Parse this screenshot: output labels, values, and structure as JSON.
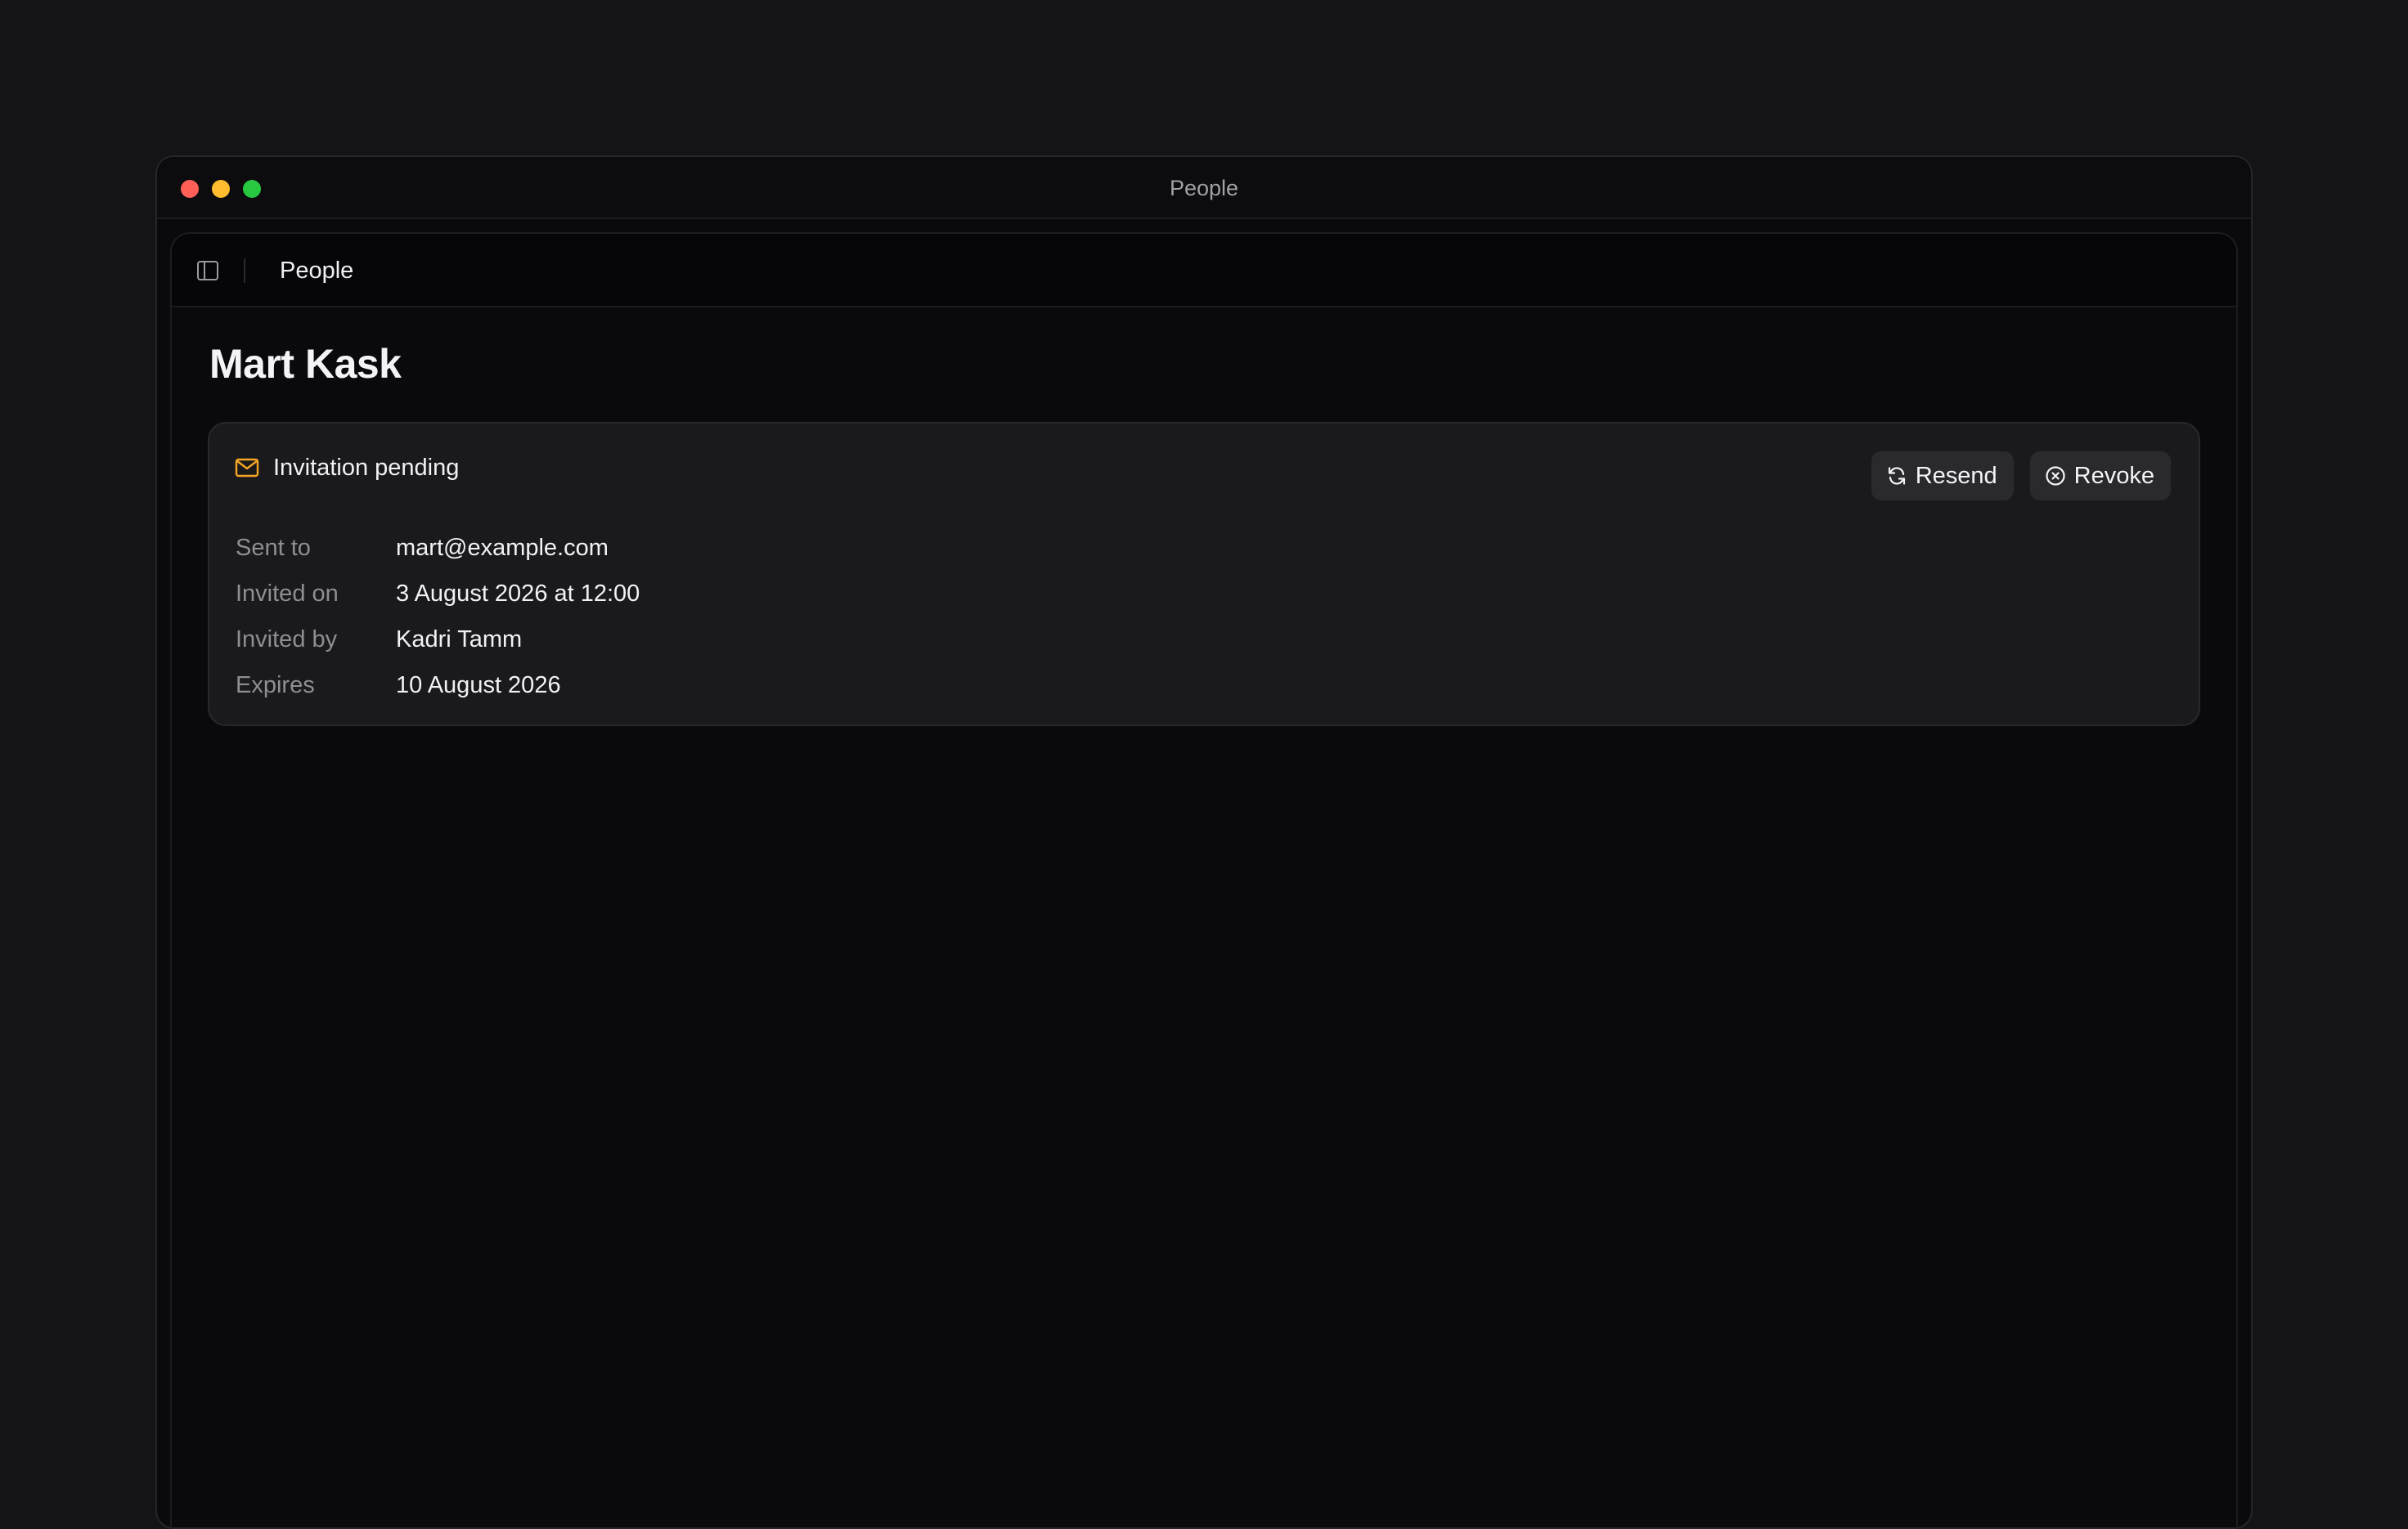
{
  "window": {
    "title": "People"
  },
  "header": {
    "breadcrumb": "People"
  },
  "page": {
    "title": "Mart Kask"
  },
  "invitation": {
    "status": "Invitation pending",
    "status_icon": "mail-icon",
    "status_color": "#f5a524",
    "actions": {
      "resend_label": "Resend",
      "revoke_label": "Revoke"
    },
    "details": [
      {
        "label": "Sent to",
        "value": "mart@example.com"
      },
      {
        "label": "Invited on",
        "value": "3 August 2026 at 12:00"
      },
      {
        "label": "Invited by",
        "value": "Kadri Tamm"
      },
      {
        "label": "Expires",
        "value": "10 August 2026"
      }
    ]
  }
}
